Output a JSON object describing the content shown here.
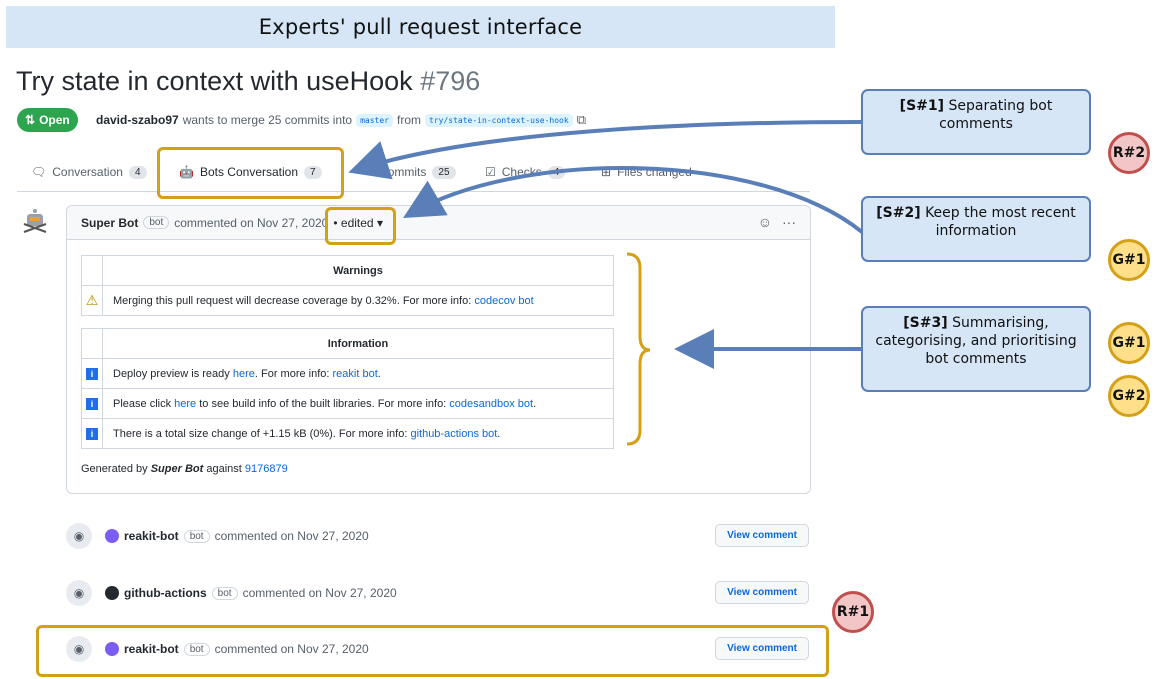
{
  "banner": "Experts' pull request interface",
  "pr": {
    "title": "Try state in context with useHook",
    "number": "#796",
    "state": "Open",
    "author": "david-szabo97",
    "meta_text": "wants to merge 25 commits into",
    "base_branch": "master",
    "from_text": "from",
    "head_branch": "try/state-in-context-use-hook"
  },
  "tabs": [
    {
      "label": "Conversation",
      "count": "4"
    },
    {
      "label": "Bots Conversation",
      "count": "7"
    },
    {
      "label": "Commits",
      "count": "25"
    },
    {
      "label": "Checks",
      "count": "4"
    },
    {
      "label": "Files changed",
      "count": ""
    }
  ],
  "comment": {
    "author": "Super Bot",
    "role": "bot",
    "action": "commented on Nov 27, 2020",
    "edited": "• edited",
    "warnings_header": "Warnings",
    "warning_text": "Merging this pull request will decrease coverage by 0.32%. For more info: ",
    "warning_link": "codecov bot",
    "info_header": "Information",
    "info_rows": [
      {
        "pre": "Deploy preview is ready ",
        "link1": "here",
        "mid": ". For more info: ",
        "link2": "reakit bot",
        "post": "."
      },
      {
        "pre": "Please click ",
        "link1": "here",
        "mid": " to see build info of the built libraries. For more info: ",
        "link2": "codesandbox bot",
        "post": "."
      },
      {
        "pre": "There is a total size change of +1.15 kB (0%). For more info: ",
        "link1": "",
        "mid": "",
        "link2": "github-actions bot",
        "post": "."
      }
    ],
    "generated_pre": "Generated by ",
    "generated_by": "Super Bot",
    "generated_mid": " against ",
    "commit": "9176879"
  },
  "timeline": [
    {
      "user": "reakit-bot",
      "role": "bot",
      "action": "commented on Nov 27, 2020",
      "button": "View comment",
      "avatar_color": "#7b5cf5"
    },
    {
      "user": "github-actions",
      "role": "bot",
      "action": "commented on Nov 27, 2020",
      "button": "View comment",
      "avatar_color": "#24292f"
    },
    {
      "user": "reakit-bot",
      "role": "bot",
      "action": "commented on Nov 27, 2020",
      "button": "View comment",
      "avatar_color": "#7b5cf5"
    }
  ],
  "callouts": [
    {
      "tag": "[S#1]",
      "text": "Separating bot comments"
    },
    {
      "tag": "[S#2]",
      "text": "Keep the most recent information"
    },
    {
      "tag": "[S#3]",
      "text": "Summarising, categorising, and prioritising bot comments"
    }
  ],
  "badges": {
    "r2": "R#2",
    "g1a": "G#1",
    "g1b": "G#1",
    "g2": "G#2",
    "r1": "R#1"
  },
  "colors": {
    "highlight": "#d4a017",
    "callout_bg": "#d6e6f7",
    "callout_border": "#5a7fb8",
    "open_green": "#2da44e",
    "link": "#0969da"
  }
}
